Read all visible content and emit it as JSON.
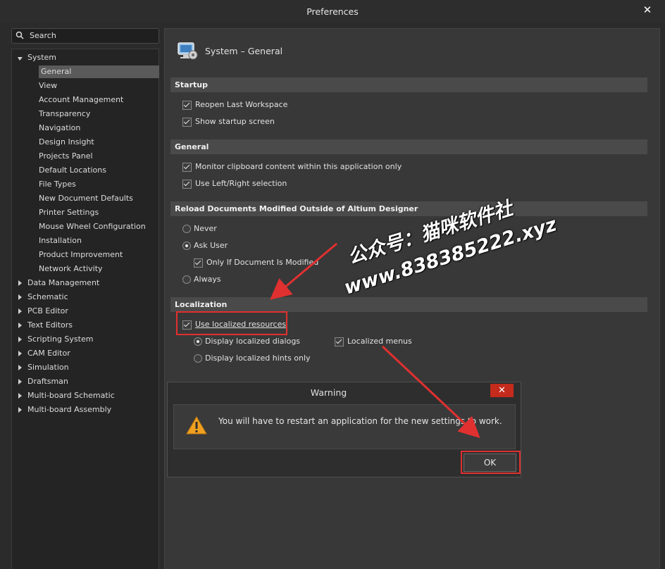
{
  "window": {
    "title": "Preferences",
    "close_glyph": "✕"
  },
  "search": {
    "label": "Search"
  },
  "tree": {
    "system": "System",
    "system_children": [
      "General",
      "View",
      "Account Management",
      "Transparency",
      "Navigation",
      "Design Insight",
      "Projects Panel",
      "Default Locations",
      "File Types",
      "New Document Defaults",
      "Printer Settings",
      "Mouse Wheel Configuration",
      "Installation",
      "Product Improvement",
      "Network Activity"
    ],
    "others": [
      "Data Management",
      "Schematic",
      "PCB Editor",
      "Text Editors",
      "Scripting System",
      "CAM Editor",
      "Simulation",
      "Draftsman",
      "Multi-board Schematic",
      "Multi-board Assembly"
    ]
  },
  "page": {
    "title": "System – General"
  },
  "startup": {
    "header": "Startup",
    "reopen": "Reopen Last Workspace",
    "show_startup": "Show startup screen"
  },
  "general": {
    "header": "General",
    "clipboard": "Monitor clipboard content within this application only",
    "leftright": "Use Left/Right selection"
  },
  "reload": {
    "header": "Reload Documents Modified Outside of Altium Designer",
    "never": "Never",
    "ask": "Ask User",
    "only_if": "Only If Document Is Modified",
    "always": "Always"
  },
  "localization": {
    "header": "Localization",
    "use_localized": "Use localized resources",
    "dialogs": "Display localized dialogs",
    "hints": "Display localized hints only",
    "menus": "Localized menus"
  },
  "warning": {
    "title": "Warning",
    "close_glyph": "✕",
    "message": "You will have to restart an application for the new settings to work.",
    "ok": "OK"
  },
  "watermark": {
    "line1": "公众号：猫咪软件社",
    "line2": "www.838385222.xyz"
  },
  "colors": {
    "highlight_red": "#e03030",
    "warning_icon": "#f0a020",
    "close_red": "#c42b1c"
  }
}
